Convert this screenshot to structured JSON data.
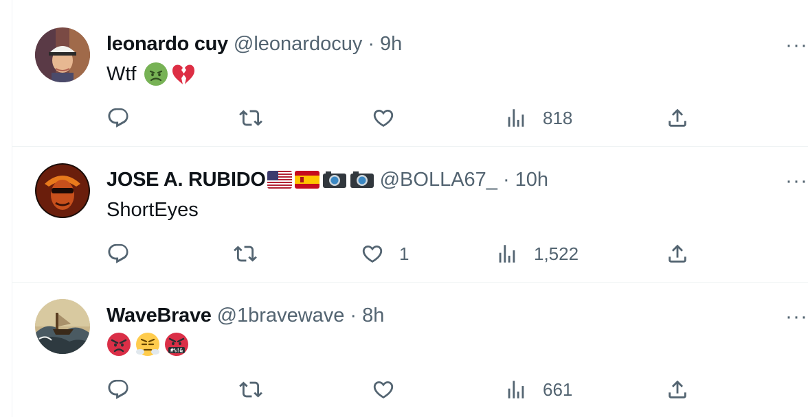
{
  "tweets": [
    {
      "name": "leonardo cuy",
      "handle": "@leonardocuy",
      "separator": "·",
      "time": "9h",
      "text": "Wtf",
      "emojis": [
        "nauseated-face-emoji",
        "broken-heart-emoji"
      ],
      "metrics": {
        "replies": "",
        "retweets": "",
        "likes": "",
        "views": "818"
      }
    },
    {
      "name": "JOSE A. RUBIDO",
      "name_flags": [
        "us-flag-icon",
        "spain-flag-icon",
        "camera-icon",
        "camera-icon"
      ],
      "handle": "@BOLLA67_",
      "separator": "·",
      "time": "10h",
      "text": "ShortEyes",
      "metrics": {
        "replies": "",
        "retweets": "",
        "likes": "1",
        "views": "1,522"
      }
    },
    {
      "name": "WaveBrave",
      "handle": "@1bravewave",
      "separator": "·",
      "time": "8h",
      "text": "",
      "emojis": [
        "pouting-face-emoji",
        "face-with-steam-emoji",
        "face-with-symbols-emoji"
      ],
      "emoji_symbol_text": "#%!&",
      "metrics": {
        "replies": "",
        "retweets": "",
        "likes": "",
        "views": "661"
      }
    }
  ],
  "more_label": "···",
  "colors": {
    "text": "#0f1419",
    "secondary": "#536471",
    "border": "#eff3f4"
  }
}
